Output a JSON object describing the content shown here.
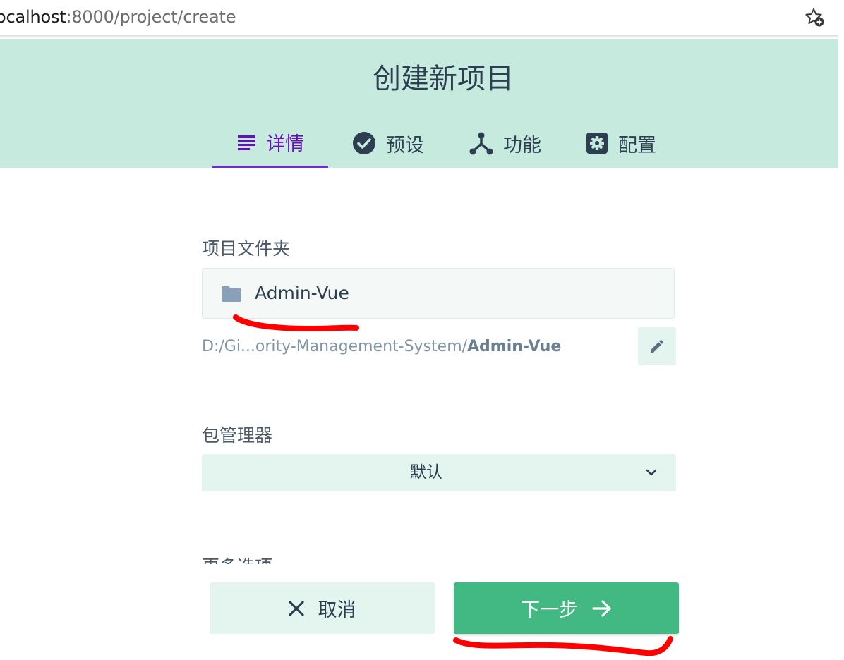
{
  "browser": {
    "url_host": "ocalhost",
    "url_path": ":8000/project/create",
    "bookmark_icon": "star-plus-icon"
  },
  "header": {
    "title": "创建新项目",
    "tabs": [
      {
        "label": "详情",
        "icon": "list-icon",
        "active": true
      },
      {
        "label": "预设",
        "icon": "check-circle-icon",
        "active": false
      },
      {
        "label": "功能",
        "icon": "fork-icon",
        "active": false
      },
      {
        "label": "配置",
        "icon": "gear-icon",
        "active": false
      }
    ]
  },
  "form": {
    "folder_label": "项目文件夹",
    "folder_icon": "folder-icon",
    "folder_name": "Admin-Vue",
    "path_prefix": "D:/Gi...ority-Management-System/",
    "path_folder": "Admin-Vue",
    "edit_icon": "pencil-icon",
    "package_manager_label": "包管理器",
    "package_manager_value": "默认",
    "more_options_label": "更多选项"
  },
  "footer": {
    "cancel_label": "取消",
    "next_label": "下一步"
  },
  "colors": {
    "header_bg": "#c7eadf",
    "accent": "#42b983",
    "active_tab": "#6a0dc1",
    "annotation": "#ff0000"
  }
}
